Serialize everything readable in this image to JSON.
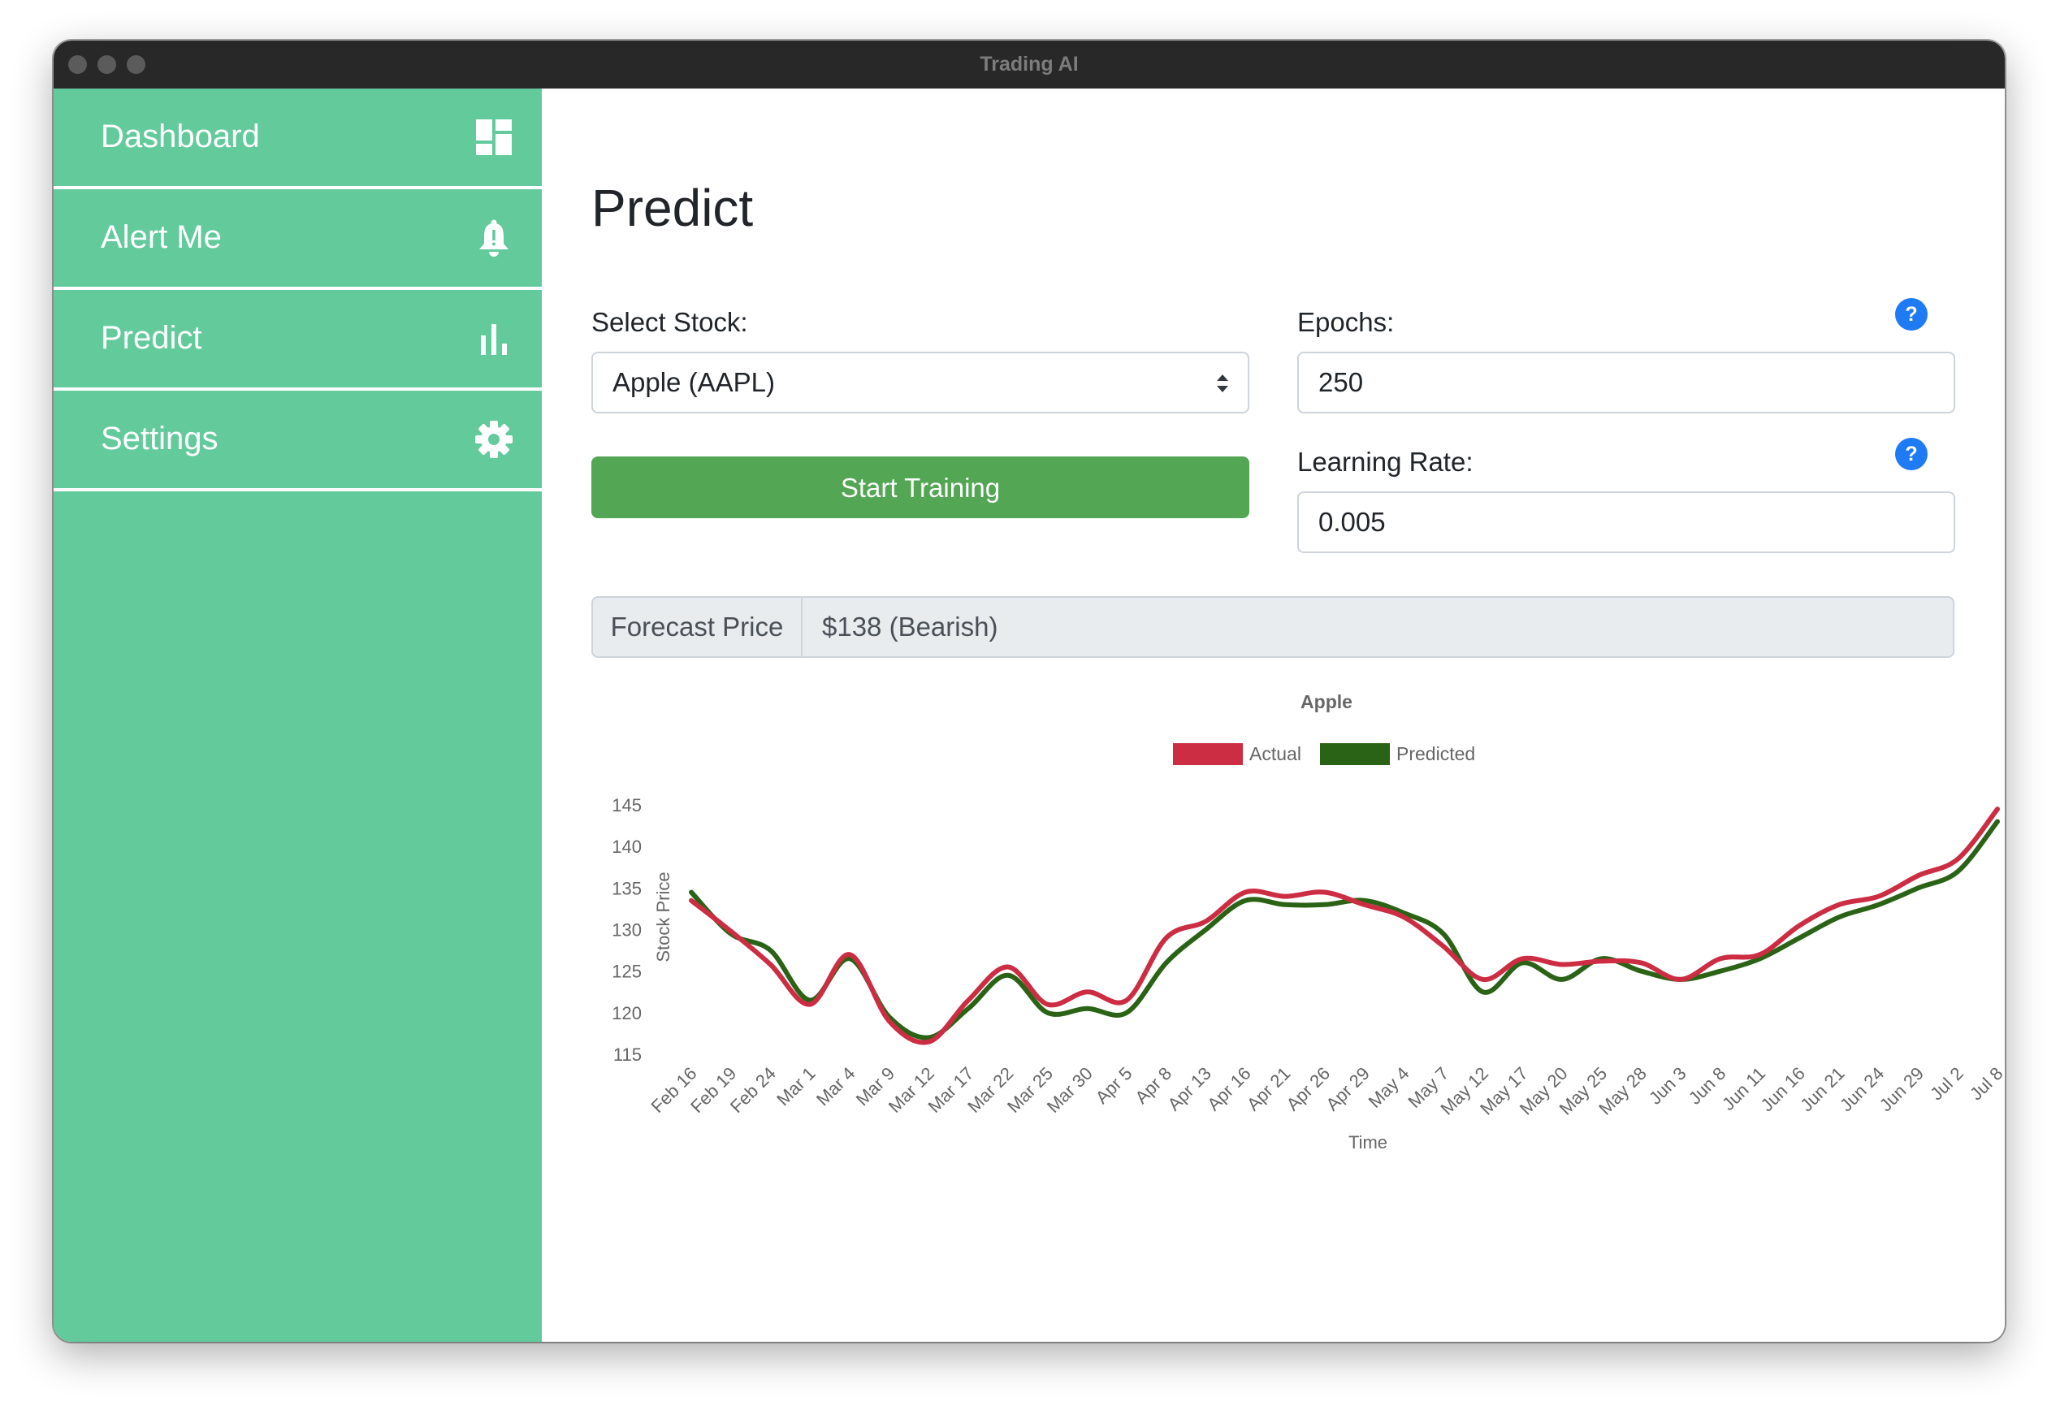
{
  "window": {
    "title": "Trading AI"
  },
  "sidebar": {
    "items": [
      {
        "label": "Dashboard",
        "icon": "dashboard-icon"
      },
      {
        "label": "Alert Me",
        "icon": "bell-icon"
      },
      {
        "label": "Predict",
        "icon": "bar-chart-icon"
      },
      {
        "label": "Settings",
        "icon": "gear-icon"
      }
    ]
  },
  "main": {
    "title": "Predict",
    "select_stock": {
      "label": "Select Stock:",
      "value": "Apple (AAPL)"
    },
    "epochs": {
      "label": "Epochs:",
      "value": "250",
      "help": "?"
    },
    "learning_rate": {
      "label": "Learning Rate:",
      "value": "0.005",
      "help": "?"
    },
    "start_button": "Start Training",
    "forecast": {
      "label": "Forecast Price",
      "value": "$138 (Bearish)"
    }
  },
  "colors": {
    "sidebar": "#63ca9c",
    "button": "#53a653",
    "help": "#1f7bf4",
    "actual": "#cc2d43",
    "predicted": "#2b6316"
  },
  "chart_data": {
    "type": "line",
    "title": "Apple",
    "xlabel": "Time",
    "ylabel": "Stock Price",
    "ylim": [
      115,
      145
    ],
    "yticks": [
      145,
      140,
      135,
      130,
      125,
      120,
      115
    ],
    "legend_position": "top",
    "x": [
      "Feb 16",
      "Feb 19",
      "Feb 24",
      "Mar 1",
      "Mar 4",
      "Mar 9",
      "Mar 12",
      "Mar 17",
      "Mar 22",
      "Mar 25",
      "Mar 30",
      "Apr 5",
      "Apr 8",
      "Apr 13",
      "Apr 16",
      "Apr 21",
      "Apr 26",
      "Apr 29",
      "May 4",
      "May 7",
      "May 12",
      "May 17",
      "May 20",
      "May 25",
      "May 28",
      "Jun 3",
      "Jun 8",
      "Jun 11",
      "Jun 16",
      "Jun 21",
      "Jun 24",
      "Jun 29",
      "Jul 2",
      "Jul 8"
    ],
    "series": [
      {
        "name": "Actual",
        "color": "#cc2d43",
        "values": [
          133.5,
          129.8,
          125.8,
          121.0,
          127.0,
          119.0,
          116.5,
          121.5,
          125.5,
          121.0,
          122.5,
          121.5,
          129.0,
          131.0,
          134.5,
          134.0,
          134.5,
          133.0,
          131.5,
          128.0,
          124.0,
          126.5,
          125.8,
          126.2,
          126.0,
          124.0,
          126.5,
          127.0,
          130.5,
          133.0,
          134.0,
          136.5,
          138.5,
          144.5
        ]
      },
      {
        "name": "Predicted",
        "color": "#2b6316",
        "values": [
          134.5,
          129.5,
          127.5,
          121.5,
          126.5,
          119.5,
          117.0,
          120.5,
          124.5,
          120.0,
          120.5,
          120.0,
          126.0,
          130.0,
          133.5,
          133.0,
          133.0,
          133.5,
          132.0,
          129.5,
          122.5,
          126.0,
          124.0,
          126.5,
          125.0,
          124.0,
          125.0,
          126.5,
          129.0,
          131.5,
          133.0,
          135.0,
          137.0,
          143.0
        ]
      }
    ]
  }
}
